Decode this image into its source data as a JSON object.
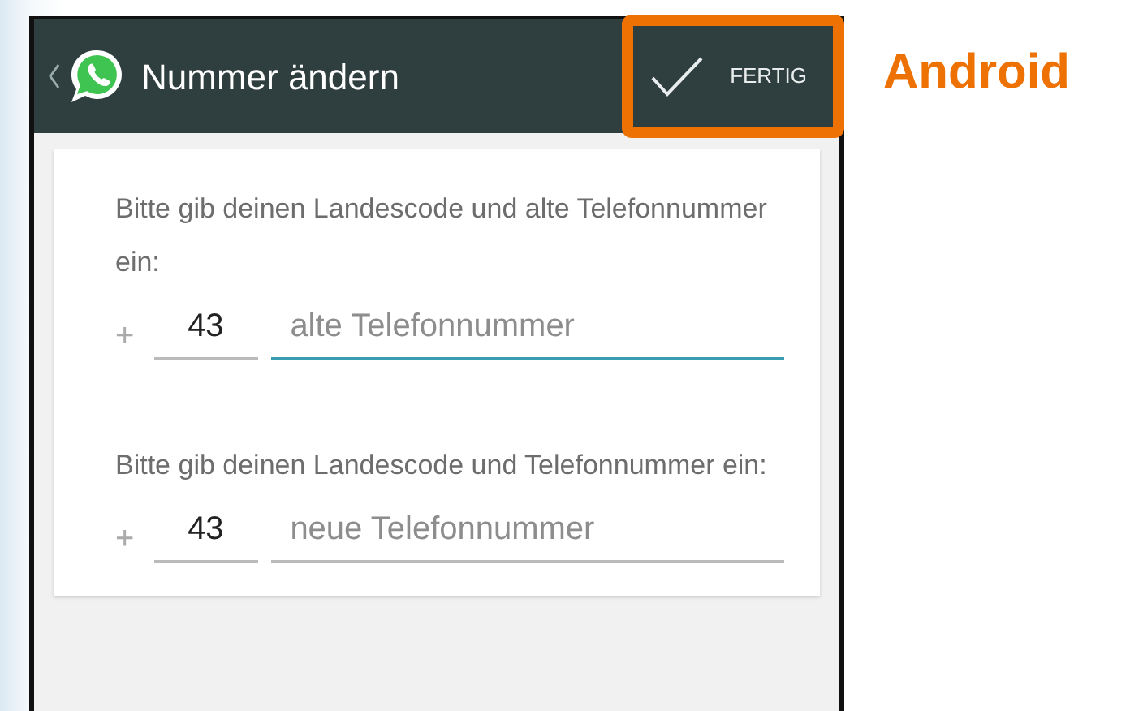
{
  "app_bar": {
    "title": "Nummer ändern",
    "done_button": {
      "label": "FERTIG",
      "highlighted": true
    }
  },
  "annotation": {
    "label": "Android"
  },
  "sections": [
    {
      "prompt": "Bitte gib deinen Landescode und alte Telefonnummer ein:",
      "plus": "+",
      "country_code": "43",
      "placeholder": "alte Telefonnummer",
      "focused": true
    },
    {
      "prompt": "Bitte gib deinen Landescode und Telefonnummer ein:",
      "plus": "+",
      "country_code": "43",
      "placeholder": "neue Telefonnummer",
      "focused": false
    }
  ]
}
